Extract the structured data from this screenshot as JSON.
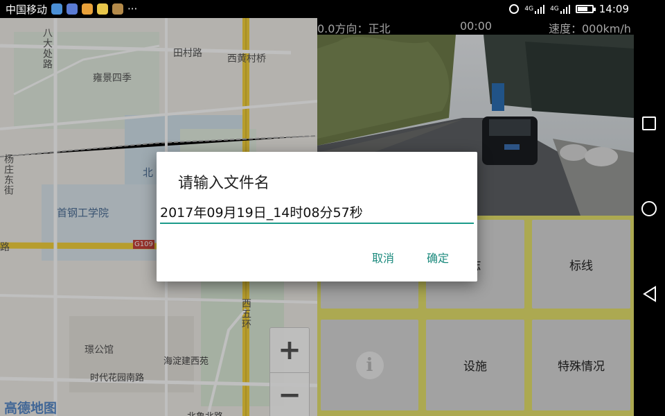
{
  "status_bar": {
    "carrier": "中国移动",
    "more": "···",
    "network_top": "4G",
    "network_bottom": "4G",
    "battery_level": 0.7,
    "time": "14:09"
  },
  "camera_header": {
    "direction": "0.0方向：正北",
    "elapsed": "00:00",
    "speed": "速度：000km/h"
  },
  "map": {
    "labels": {
      "bajiao": "八大处路",
      "tiancun": "田村路",
      "xihuangcun": "西黄村桥",
      "yongjing": "雍景四季",
      "bei": "北",
      "yangzhuang": "杨庄东街",
      "shougang": "首钢工学院",
      "g109": "G109",
      "lu": "路",
      "xiwuhuan": "西五环",
      "jingong": "璟公馆",
      "haidian": "海淀建西苑",
      "shidai": "时代花园南路",
      "bottom_road": "北鲁北路"
    },
    "zoom_in": "+",
    "zoom_out": "−",
    "logo": "高德地图"
  },
  "grid": {
    "sign_partial": "志",
    "marking": "标线",
    "facility": "设施",
    "special": "特殊情况"
  },
  "dialog": {
    "title": "请输入文件名",
    "filename": "2017年09月19日_14时08分57秒",
    "cancel": "取消",
    "confirm": "确定"
  },
  "colors": {
    "accent": "#1b9a8a",
    "grid_bg": "#e6e26c",
    "button_bg": "#d9d9d9",
    "road_main": "#f5d23d"
  }
}
